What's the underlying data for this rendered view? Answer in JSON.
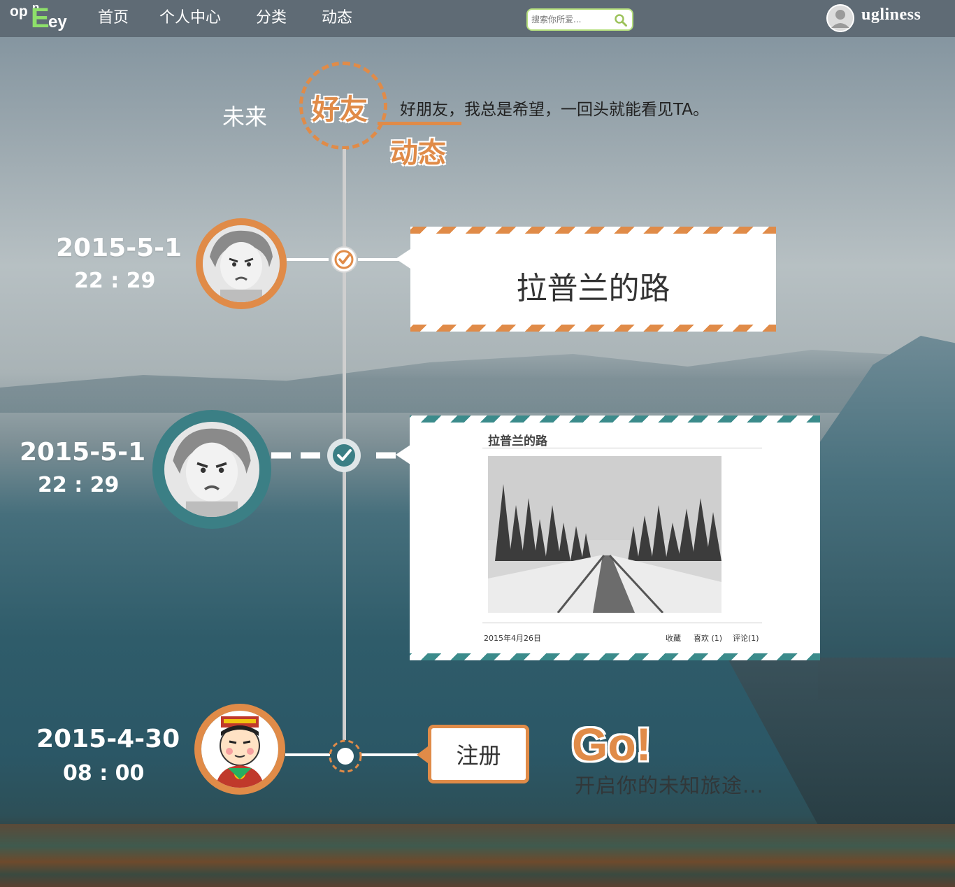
{
  "nav": {
    "logo": {
      "p1": "op",
      "p2": "n",
      "p3": "E",
      "p4": "ey"
    },
    "items": [
      "首页",
      "个人中心",
      "分类",
      "动态"
    ],
    "search_placeholder": "搜索你所爱...",
    "username": "ugliness"
  },
  "header": {
    "future_label": "未来",
    "badge_friends": "好友",
    "badge_activity": "动态",
    "tagline": "好朋友，我总是希望，一回头就能看见TA。"
  },
  "timeline": [
    {
      "date": "2015-5-1",
      "time": "22 : 29",
      "card_title": "拉普兰的路"
    },
    {
      "date": "2015-5-1",
      "time": "22 : 29",
      "card_title": "拉普兰的路",
      "post_date": "2015年4月26日",
      "favorite": "收藏",
      "like": "喜欢 (1)",
      "comment": "评论(1)"
    },
    {
      "date": "2015-4-30",
      "time": "08 : 00"
    }
  ],
  "register_label": "注册",
  "go": {
    "title": "Go!",
    "subtitle": "开启你的未知旅途..."
  },
  "colors": {
    "orange": "#e08b48",
    "teal": "#3b8b8b",
    "green_accent": "#8ee06a",
    "navbar": "#5f6b75"
  }
}
